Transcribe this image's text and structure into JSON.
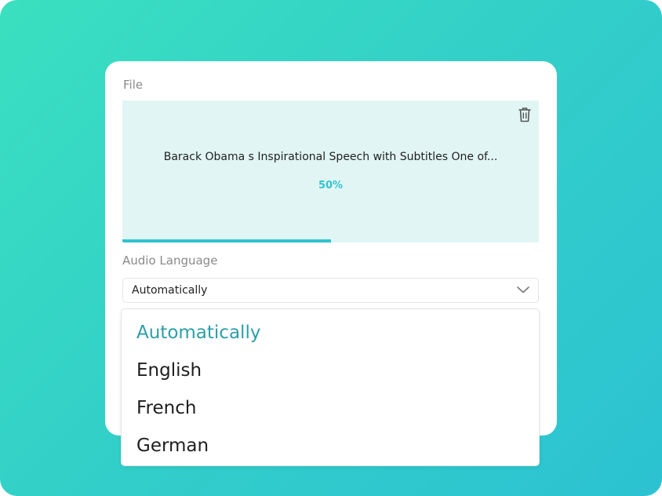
{
  "file_section": {
    "label": "File",
    "file_name": "Barack Obama s Inspirational Speech with Subtitles One of...",
    "progress_text": "50%",
    "progress_value": 0.5,
    "delete_icon": "trash-icon"
  },
  "audio_language": {
    "label": "Audio Language",
    "selected": "Automatically",
    "chevron_icon": "chevron-down-icon",
    "options": [
      "Automatically",
      "English",
      "French",
      "German"
    ]
  },
  "colors": {
    "accent": "#2ec3cf",
    "selected_option": "#2c9fa9",
    "file_box_bg": "#e1f6f4",
    "background_start": "#3ae0c0",
    "background_end": "#2cc2d2"
  }
}
